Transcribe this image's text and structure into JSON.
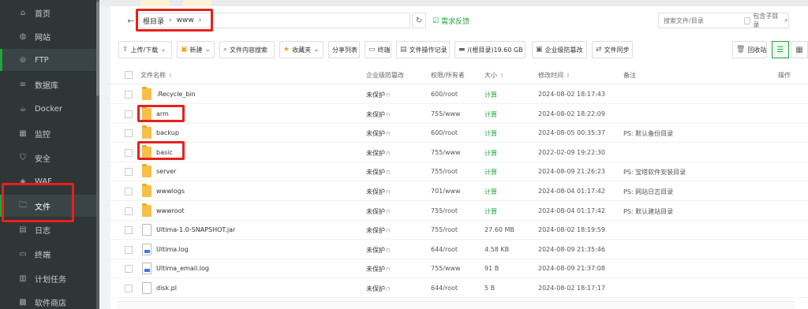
{
  "sidebar": {
    "items": [
      {
        "label": "首页",
        "icon": "home-icon",
        "glyph": "⌂"
      },
      {
        "label": "网站",
        "icon": "globe-icon",
        "glyph": "◍"
      },
      {
        "label": "FTP",
        "icon": "ftp-icon",
        "glyph": "⊜"
      },
      {
        "label": "数据库",
        "icon": "database-icon",
        "glyph": "≡"
      },
      {
        "label": "Docker",
        "icon": "docker-icon",
        "glyph": "☕"
      },
      {
        "label": "监控",
        "icon": "monitor-icon",
        "glyph": "▦"
      },
      {
        "label": "安全",
        "icon": "shield-icon",
        "glyph": "⛉"
      },
      {
        "label": "WAF",
        "icon": "waf-icon",
        "glyph": "◈"
      },
      {
        "label": "文件",
        "icon": "folder-icon",
        "glyph": "🗀"
      },
      {
        "label": "日志",
        "icon": "log-icon",
        "glyph": "▤"
      },
      {
        "label": "终端",
        "icon": "terminal-icon",
        "glyph": "▭"
      },
      {
        "label": "计划任务",
        "icon": "schedule-icon",
        "glyph": "▥"
      },
      {
        "label": "软件商店",
        "icon": "store-icon",
        "glyph": "▩"
      }
    ]
  },
  "path": {
    "segments": [
      "根目录",
      "www"
    ],
    "back_glyph": "←",
    "sep": "›",
    "refresh_glyph": "↻",
    "feedback_label": "需求反馈",
    "feedback_glyph": "☑"
  },
  "search": {
    "placeholder": "搜索文件/目录",
    "include_sub_label": "包含子目录",
    "search_glyph": "⌕"
  },
  "toolbar": {
    "upload": "上传/下载",
    "new": "新建",
    "content_search": "文件内容搜索",
    "favorites": "收藏夹",
    "share_list": "分享列表",
    "terminal": "终端",
    "op_log": "文件操作记录",
    "disk": "/(根目录)19.60 GB",
    "enterprise_protect": "企业级防篡改",
    "file_sync": "文件同步",
    "recycle": "回收站"
  },
  "table": {
    "headers": {
      "name": "文件名称",
      "protect": "企业级防篡改",
      "perm": "权限/所有者",
      "size": "大小",
      "mtime": "修改时间",
      "note": "备注",
      "ops": "操作"
    },
    "rows": [
      {
        "name": ".Recycle_bin",
        "type": "folder",
        "protect": "未保护",
        "perm": "600/root",
        "size": "计算",
        "size_link": true,
        "mtime": "2024-08-02 18:17:43",
        "note": ""
      },
      {
        "name": "arm",
        "type": "folder",
        "protect": "未保护",
        "perm": "755/www",
        "size": "计算",
        "size_link": true,
        "mtime": "2024-08-02 18:22:09",
        "note": ""
      },
      {
        "name": "backup",
        "type": "folder",
        "protect": "未保护",
        "perm": "600/root",
        "size": "计算",
        "size_link": true,
        "mtime": "2024-08-05 00:35:37",
        "note": "PS: 默认备份目录"
      },
      {
        "name": "basic",
        "type": "folder",
        "protect": "未保护",
        "perm": "755/www",
        "size": "计算",
        "size_link": true,
        "mtime": "2022-02-09 19:22:30",
        "note": ""
      },
      {
        "name": "server",
        "type": "folder",
        "protect": "未保护",
        "perm": "755/root",
        "size": "计算",
        "size_link": true,
        "mtime": "2024-08-09 21:26:23",
        "note": "PS: 宝塔软件安装目录"
      },
      {
        "name": "wwwlogs",
        "type": "folder",
        "protect": "未保护",
        "perm": "701/www",
        "size": "计算",
        "size_link": true,
        "mtime": "2024-08-04 01:17:42",
        "note": "PS: 网站日志目录"
      },
      {
        "name": "wwwroot",
        "type": "folder",
        "protect": "未保护",
        "perm": "755/root",
        "size": "计算",
        "size_link": true,
        "mtime": "2024-08-04 01:17:42",
        "note": "PS: 默认建站目录"
      },
      {
        "name": "Ultima-1.0-SNAPSHOT.jar",
        "type": "file",
        "protect": "未保护",
        "perm": "755/root",
        "size": "27.60 MB",
        "size_link": false,
        "mtime": "2024-08-02 18:19:59",
        "note": ""
      },
      {
        "name": "Ultima.log",
        "type": "log",
        "protect": "未保护",
        "perm": "644/root",
        "size": "4.58 KB",
        "size_link": false,
        "mtime": "2024-08-09 21:35:46",
        "note": ""
      },
      {
        "name": "Ultima_email.log",
        "type": "log",
        "protect": "未保护",
        "perm": "755/www",
        "size": "91 B",
        "size_link": false,
        "mtime": "2024-08-09 21:37:08",
        "note": ""
      },
      {
        "name": "disk.pl",
        "type": "file",
        "protect": "未保护",
        "perm": "644/root",
        "size": "5 B",
        "size_link": false,
        "mtime": "2024-08-02 18:17:17",
        "note": ""
      }
    ]
  },
  "colors": {
    "accent": "#20a53a",
    "highlight": "#e8201a",
    "sidebar_bg": "#2e3638"
  }
}
